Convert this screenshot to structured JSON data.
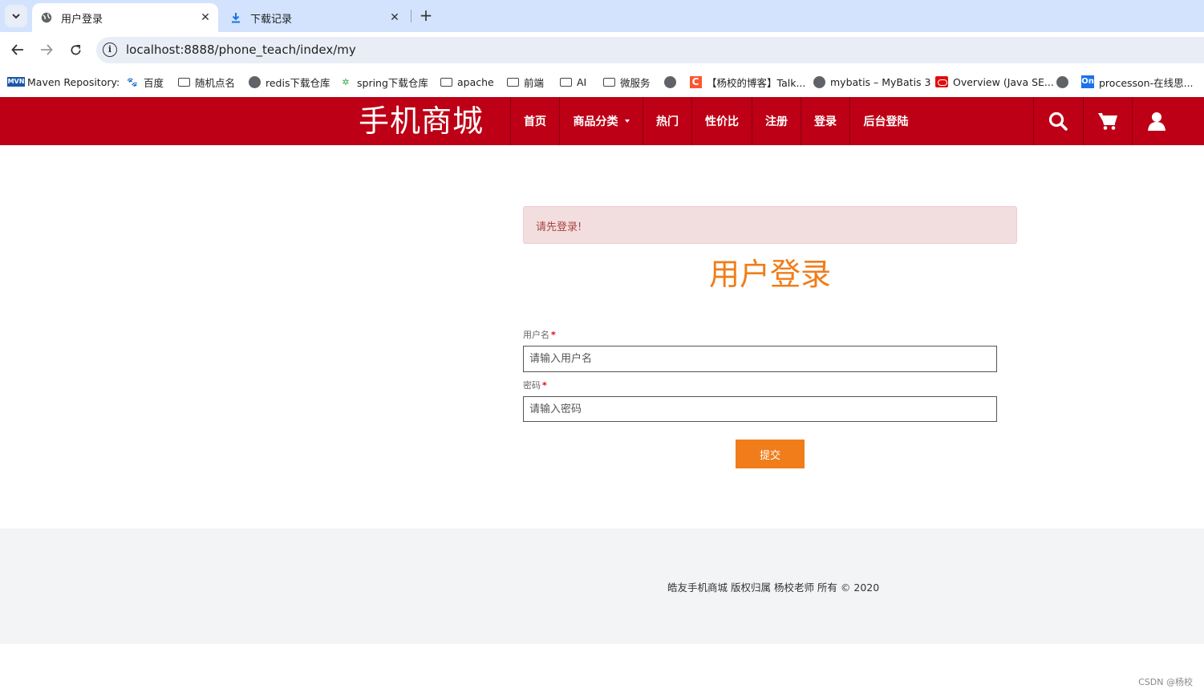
{
  "browser": {
    "tabs": [
      {
        "title": "用户登录",
        "icon": "globe-icon",
        "active": true
      },
      {
        "title": "下载记录",
        "icon": "download-icon",
        "active": false
      }
    ],
    "url": "localhost:8888/phone_teach/index/my",
    "bookmarks": [
      {
        "label": "Maven Repository:",
        "icon": "maven-icon"
      },
      {
        "label": "百度",
        "icon": "baidu-icon"
      },
      {
        "label": "随机点名",
        "icon": "folder-icon"
      },
      {
        "label": "redis下载仓库",
        "icon": "globe-icon"
      },
      {
        "label": "spring下载仓库",
        "icon": "spring-icon"
      },
      {
        "label": "apache",
        "icon": "folder-icon"
      },
      {
        "label": "前端",
        "icon": "folder-icon"
      },
      {
        "label": "AI",
        "icon": "folder-icon"
      },
      {
        "label": "微服务",
        "icon": "folder-icon"
      },
      {
        "label": "",
        "icon": "globe-icon"
      },
      {
        "label": "【杨校的博客】Talk...",
        "icon": "csdn-icon"
      },
      {
        "label": "mybatis – MyBatis 3",
        "icon": "globe-icon"
      },
      {
        "label": "Overview (Java SE...",
        "icon": "oracle-icon"
      },
      {
        "label": "",
        "icon": "globe-icon"
      },
      {
        "label": "processon-在线思...",
        "icon": "processon-icon"
      }
    ]
  },
  "site": {
    "brand": "手机商城",
    "brand_color": "#bd0016",
    "accent_color": "#f07d1a",
    "nav": [
      {
        "label": "首页"
      },
      {
        "label": "商品分类",
        "dropdown": true
      },
      {
        "label": "热门"
      },
      {
        "label": "性价比"
      },
      {
        "label": "注册"
      },
      {
        "label": "登录"
      },
      {
        "label": "后台登陆"
      }
    ],
    "nav_icons": [
      "search-icon",
      "cart-icon",
      "user-icon"
    ]
  },
  "login": {
    "alert": "请先登录!",
    "title": "用户登录",
    "username_label": "用户名",
    "username_placeholder": "请输入用户名",
    "password_label": "密码",
    "password_placeholder": "请输入密码",
    "required_mark": "*",
    "submit": "提交"
  },
  "footer": {
    "copyright": "皓友手机商城 版权归属 杨校老师 所有 © 2020"
  },
  "watermark": "CSDN @杨校"
}
